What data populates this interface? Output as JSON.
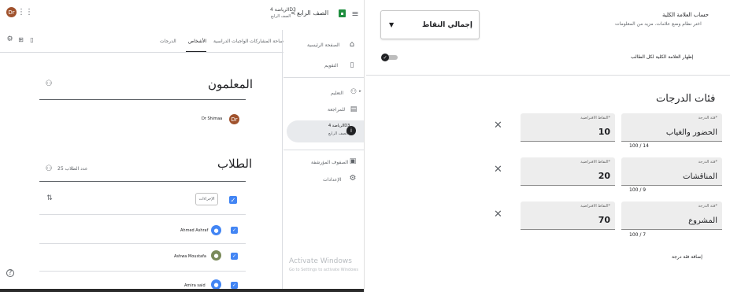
{
  "classroom": {
    "header": {
      "avatar_initials": "Dr",
      "class_name": "الصف الرابع",
      "breadcrumb_sep": "<",
      "class_code_title": "الرياضة 4D3",
      "class_subtitle": "الصف الرابع"
    },
    "tabs": [
      "ساحة المشاركات",
      "الواجبات الدراسية",
      "الأشخاص",
      "الدرجات"
    ],
    "active_tab": "الأشخاص",
    "teachers": {
      "title": "المعلمون",
      "teacher_name": "Dr Shimaa",
      "teacher_initials": "Dr"
    },
    "students": {
      "title": "الطلاب",
      "count_text": "عدد الطلاب 25",
      "actions_label": "الإجراءات",
      "list": [
        {
          "name": "Ahmed Ashraf"
        },
        {
          "name": "Ashwa Moustafa"
        },
        {
          "name": "Amira said"
        }
      ]
    },
    "sidebar": {
      "items": [
        {
          "label": "الصفحة الرئيسية",
          "icon": "home-icon"
        },
        {
          "label": "التقويم",
          "icon": "calendar-icon"
        },
        {
          "label": "التعليم",
          "icon": "people-icon"
        },
        {
          "label": "للمراجعة",
          "icon": "assignment-icon"
        },
        {
          "label": "الرياضة 4D3",
          "sub": "الصف الرابع",
          "icon": "class-icon"
        },
        {
          "label": "الصفوف المؤرشفة",
          "icon": "archive-icon"
        },
        {
          "label": "الإعدادات",
          "icon": "settings-icon"
        }
      ]
    },
    "watermark": {
      "line1": "Activate Windows",
      "line2": "Go to Settings to activate Windows"
    }
  },
  "grading": {
    "calc_title": "حساب العلامة الكلية",
    "calc_desc": "اختر نظام وضع علامات. مزيد من المعلومات",
    "calc_select_value": "إجمالي النقاط",
    "show_total_label": "إظهار العلامة الكلية لكل الطالب",
    "categories_title": "فئات الدرجات",
    "category_label": "فئة الدرجة*",
    "points_label": "النقاط الافتراضية*",
    "categories": [
      {
        "name": "الحضور والغياب",
        "points": "10",
        "count": "100 / 14"
      },
      {
        "name": "المناقشات",
        "points": "20",
        "count": "100 / 9"
      },
      {
        "name": "المشروع",
        "points": "70",
        "count": "100 / 7"
      }
    ],
    "add_category_label": "إضافة فئة درجة",
    "remove_symbol": "✕"
  }
}
